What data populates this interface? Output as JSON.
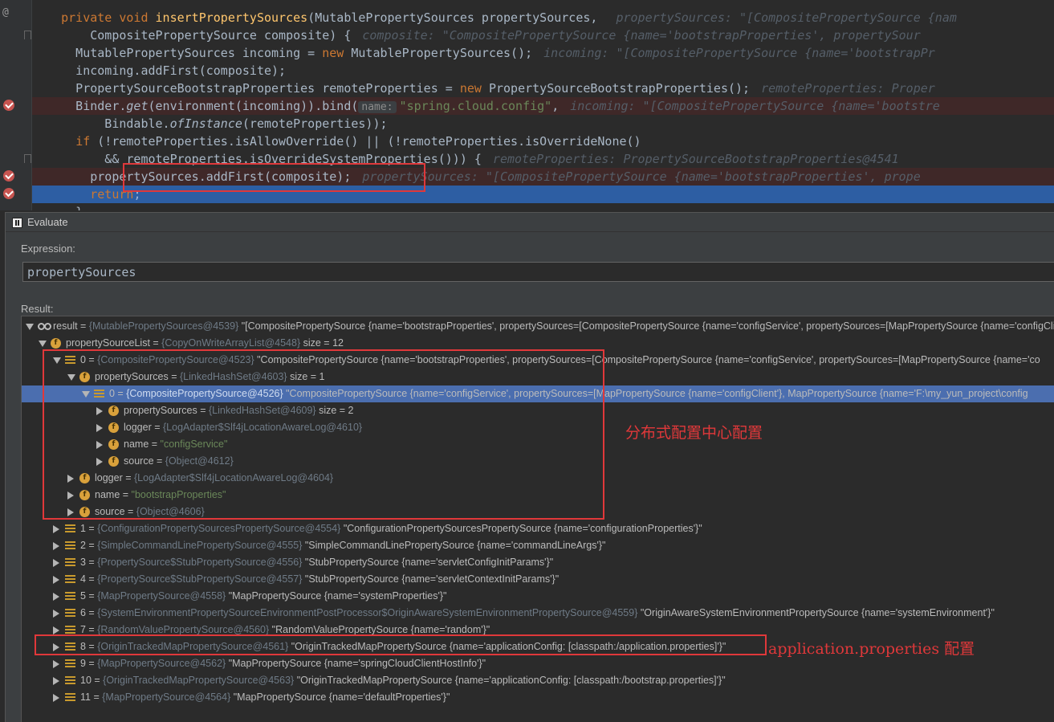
{
  "editor": {
    "lines": [
      {
        "segments": [
          {
            "t": "    "
          },
          {
            "t": "private ",
            "c": "kw"
          },
          {
            "t": "void ",
            "c": "kw"
          },
          {
            "t": "insertPropertySources",
            "c": "fn"
          },
          {
            "t": "(MutablePropertySources propertySources, "
          }
        ],
        "hint": "propertySources: \"[CompositePropertySource {nam"
      },
      {
        "segments": [
          {
            "t": "        CompositePropertySource composite) {"
          }
        ],
        "hint": "composite: \"CompositePropertySource {name='bootstrapProperties', propertySour"
      },
      {
        "segments": [
          {
            "t": "      MutablePropertySources incoming = "
          },
          {
            "t": "new ",
            "c": "kw"
          },
          {
            "t": "MutablePropertySources();"
          }
        ],
        "hint": "incoming: \"[CompositePropertySource {name='bootstrapPr"
      },
      {
        "segments": [
          {
            "t": "      incoming.addFirst(composite);"
          }
        ],
        "hint": ""
      },
      {
        "segments": [
          {
            "t": "      PropertySourceBootstrapProperties remoteProperties = "
          },
          {
            "t": "new ",
            "c": "kw"
          },
          {
            "t": "PropertySourceBootstrapProperties();"
          }
        ],
        "hint": "remoteProperties: Proper"
      },
      {
        "segments": [
          {
            "t": "      Binder."
          },
          {
            "t": "get",
            "c": "it"
          },
          {
            "t": "(environment(incoming)).bind("
          },
          {
            "t": "name:",
            "c": "inlay"
          },
          {
            "t": "\"spring.cloud.config\"",
            "c": "str"
          },
          {
            "t": ","
          }
        ],
        "hint": "incoming: \"[CompositePropertySource {name='bootstre"
      },
      {
        "segments": [
          {
            "t": "          Bindable."
          },
          {
            "t": "ofInstance",
            "c": "it"
          },
          {
            "t": "(remoteProperties));"
          }
        ],
        "hint": ""
      },
      {
        "segments": [
          {
            "t": "      "
          },
          {
            "t": "if ",
            "c": "kw"
          },
          {
            "t": "(!remoteProperties.isAllowOverride() || (!remoteProperties.isOverrideNone()"
          }
        ],
        "hint": ""
      },
      {
        "segments": [
          {
            "t": "          && remoteProperties.isOverrideSystemProperties())) {"
          }
        ],
        "hint": "remoteProperties: PropertySourceBootstrapProperties@4541"
      },
      {
        "segments": [
          {
            "t": "        propertySources.addFirst(composite);"
          }
        ],
        "hint": "propertySources: \"[CompositePropertySource {name='bootstrapProperties', prope"
      },
      {
        "segments": [
          {
            "t": "        "
          },
          {
            "t": "return",
            "c": "kw"
          },
          {
            "t": ";"
          }
        ],
        "hint": ""
      },
      {
        "segments": [
          {
            "t": "      }"
          }
        ],
        "hint": ""
      }
    ]
  },
  "evaluate": {
    "title": "Evaluate",
    "expression_label": "Expression:",
    "expression": "propertySources",
    "result_label": "Result:",
    "tree": [
      {
        "depth": 0,
        "icon": "res",
        "toggle": "expanded",
        "name": "result",
        "type": "{MutablePropertySources@4539}",
        "value": "\"[CompositePropertySource {name='bootstrapProperties', propertySources=[CompositePropertySource {name='configService', propertySources=[MapPropertySource {name='configClient', MapPropertySource"
      },
      {
        "depth": 1,
        "icon": "field",
        "toggle": "expanded",
        "name": "propertySourceList",
        "type": "{CopyOnWriteArrayList@4548}",
        "value": " size = 12"
      },
      {
        "depth": 2,
        "icon": "arr",
        "toggle": "expanded",
        "name": "0",
        "type": "{CompositePropertySource@4523}",
        "value": "\"CompositePropertySource {name='bootstrapProperties', propertySources=[CompositePropertySource {name='configService', propertySources=[MapPropertySource {name='co"
      },
      {
        "depth": 3,
        "icon": "field",
        "toggle": "expanded",
        "name": "propertySources",
        "type": "{LinkedHashSet@4603}",
        "value": " size = 1"
      },
      {
        "depth": 4,
        "icon": "arr",
        "toggle": "expanded",
        "name": "0",
        "type": "{CompositePropertySource@4526}",
        "value": "\"CompositePropertySource {name='configService', propertySources=[MapPropertySource {name='configClient'}, MapPropertySource {name='F:\\my_yun_project\\config",
        "selected": true
      },
      {
        "depth": 5,
        "icon": "field",
        "toggle": "collapsed",
        "name": "propertySources",
        "type": "{LinkedHashSet@4609}",
        "value": " size = 2"
      },
      {
        "depth": 5,
        "icon": "field",
        "toggle": "collapsed",
        "name": "logger",
        "type": "{LogAdapter$Slf4jLocationAwareLog@4610}",
        "value": ""
      },
      {
        "depth": 5,
        "icon": "field",
        "toggle": "collapsed",
        "name": "name",
        "type": "",
        "value": "",
        "str": "\"configService\""
      },
      {
        "depth": 5,
        "icon": "field",
        "toggle": "collapsed",
        "name": "source",
        "type": "{Object@4612}",
        "value": ""
      },
      {
        "depth": 3,
        "icon": "field",
        "toggle": "collapsed",
        "name": "logger",
        "type": "{LogAdapter$Slf4jLocationAwareLog@4604}",
        "value": ""
      },
      {
        "depth": 3,
        "icon": "field",
        "toggle": "collapsed",
        "name": "name",
        "type": "",
        "value": "",
        "str": "\"bootstrapProperties\""
      },
      {
        "depth": 3,
        "icon": "field",
        "toggle": "collapsed",
        "name": "source",
        "type": "{Object@4606}",
        "value": ""
      },
      {
        "depth": 2,
        "icon": "arr",
        "toggle": "collapsed",
        "name": "1",
        "type": "{ConfigurationPropertySourcesPropertySource@4554}",
        "value": "\"ConfigurationPropertySourcesPropertySource {name='configurationProperties'}\""
      },
      {
        "depth": 2,
        "icon": "arr",
        "toggle": "collapsed",
        "name": "2",
        "type": "{SimpleCommandLinePropertySource@4555}",
        "value": "\"SimpleCommandLinePropertySource {name='commandLineArgs'}\""
      },
      {
        "depth": 2,
        "icon": "arr",
        "toggle": "collapsed",
        "name": "3",
        "type": "{PropertySource$StubPropertySource@4556}",
        "value": "\"StubPropertySource {name='servletConfigInitParams'}\""
      },
      {
        "depth": 2,
        "icon": "arr",
        "toggle": "collapsed",
        "name": "4",
        "type": "{PropertySource$StubPropertySource@4557}",
        "value": "\"StubPropertySource {name='servletContextInitParams'}\""
      },
      {
        "depth": 2,
        "icon": "arr",
        "toggle": "collapsed",
        "name": "5",
        "type": "{MapPropertySource@4558}",
        "value": "\"MapPropertySource {name='systemProperties'}\""
      },
      {
        "depth": 2,
        "icon": "arr",
        "toggle": "collapsed",
        "name": "6",
        "type": "{SystemEnvironmentPropertySourceEnvironmentPostProcessor$OriginAwareSystemEnvironmentPropertySource@4559}",
        "value": "\"OriginAwareSystemEnvironmentPropertySource {name='systemEnvironment'}\""
      },
      {
        "depth": 2,
        "icon": "arr",
        "toggle": "collapsed",
        "name": "7",
        "type": "{RandomValuePropertySource@4560}",
        "value": "\"RandomValuePropertySource {name='random'}\""
      },
      {
        "depth": 2,
        "icon": "arr",
        "toggle": "collapsed",
        "name": "8",
        "type": "{OriginTrackedMapPropertySource@4561}",
        "value": "\"OriginTrackedMapPropertySource {name='applicationConfig: [classpath:/application.properties]'}\""
      },
      {
        "depth": 2,
        "icon": "arr",
        "toggle": "collapsed",
        "name": "9",
        "type": "{MapPropertySource@4562}",
        "value": "\"MapPropertySource {name='springCloudClientHostInfo'}\""
      },
      {
        "depth": 2,
        "icon": "arr",
        "toggle": "collapsed",
        "name": "10",
        "type": "{OriginTrackedMapPropertySource@4563}",
        "value": "\"OriginTrackedMapPropertySource {name='applicationConfig: [classpath:/bootstrap.properties]'}\""
      },
      {
        "depth": 2,
        "icon": "arr",
        "toggle": "collapsed",
        "name": "11",
        "type": "{MapPropertySource@4564}",
        "value": "\"MapPropertySource {name='defaultProperties'}\""
      }
    ]
  },
  "annotations": {
    "config_center": "分布式配置中心配置",
    "application_properties": "application.properties 配置"
  },
  "colors": {
    "annotation_red": "#e0383a",
    "selection_blue": "#4b6eaf",
    "execution_line": "#2d5ea3",
    "breakpoint_line": "#3f2828"
  }
}
